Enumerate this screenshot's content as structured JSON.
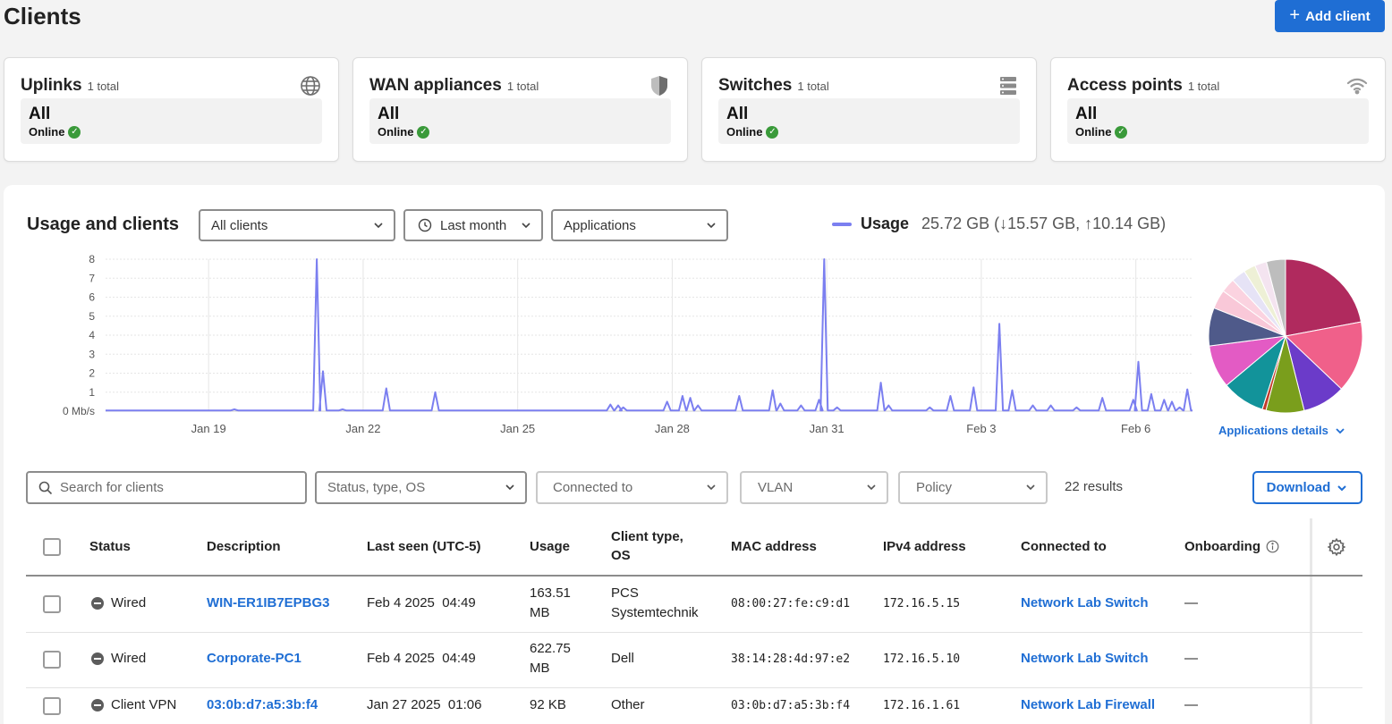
{
  "page": {
    "title": "Clients",
    "add_client_label": "Add client"
  },
  "cards": [
    {
      "title": "Uplinks",
      "total": "1 total",
      "filter": "All",
      "status": "Online",
      "icon": "globe-icon"
    },
    {
      "title": "WAN appliances",
      "total": "1 total",
      "filter": "All",
      "status": "Online",
      "icon": "shield-icon"
    },
    {
      "title": "Switches",
      "total": "1 total",
      "filter": "All",
      "status": "Online",
      "icon": "server-stack-icon"
    },
    {
      "title": "Access points",
      "total": "1 total",
      "filter": "All",
      "status": "Online",
      "icon": "wifi-icon"
    }
  ],
  "usage": {
    "title": "Usage and clients",
    "client_filter": "All clients",
    "time_filter": "Last month",
    "breakdown_filter": "Applications",
    "legend_label": "Usage",
    "legend_value": "25.72 GB (↓15.57 GB, ↑10.14 GB)",
    "apps_details_label": "Applications details"
  },
  "chart_data": {
    "type": "line",
    "series": [
      {
        "name": "Usage",
        "color": "#7b7ff0"
      }
    ],
    "ylabel_unit": "Mb/s",
    "y_ticks": [
      "0 Mb/s",
      "1",
      "2",
      "3",
      "4",
      "5",
      "6",
      "7",
      "8"
    ],
    "ylim": [
      0,
      8
    ],
    "x_ticks": [
      "Jan 19",
      "Jan 22",
      "Jan 25",
      "Jan 28",
      "Jan 31",
      "Feb 3",
      "Feb 6"
    ],
    "x_tick_days": [
      2,
      5,
      8,
      11,
      14,
      17,
      20
    ],
    "xlim_days": [
      0,
      21.1
    ],
    "spikes": [
      [
        2.5,
        0.1
      ],
      [
        4.1,
        8.0
      ],
      [
        4.22,
        2.1
      ],
      [
        4.6,
        0.1
      ],
      [
        5.45,
        1.2
      ],
      [
        6.4,
        1.0
      ],
      [
        9.8,
        0.35
      ],
      [
        9.95,
        0.3
      ],
      [
        10.05,
        0.2
      ],
      [
        10.9,
        0.5
      ],
      [
        11.2,
        0.8
      ],
      [
        11.35,
        0.7
      ],
      [
        11.5,
        0.3
      ],
      [
        12.3,
        0.8
      ],
      [
        12.95,
        1.1
      ],
      [
        13.1,
        0.4
      ],
      [
        13.5,
        0.3
      ],
      [
        13.85,
        0.6
      ],
      [
        13.95,
        8.0
      ],
      [
        14.2,
        0.2
      ],
      [
        15.05,
        1.5
      ],
      [
        15.2,
        0.3
      ],
      [
        16.0,
        0.2
      ],
      [
        16.4,
        0.8
      ],
      [
        16.85,
        1.25
      ],
      [
        17.35,
        4.6
      ],
      [
        17.6,
        1.1
      ],
      [
        18.0,
        0.3
      ],
      [
        18.35,
        0.3
      ],
      [
        18.85,
        0.2
      ],
      [
        19.35,
        0.7
      ],
      [
        19.95,
        0.6
      ],
      [
        20.05,
        2.6
      ],
      [
        20.3,
        0.9
      ],
      [
        20.55,
        0.6
      ],
      [
        20.7,
        0.5
      ],
      [
        20.85,
        0.2
      ],
      [
        21.0,
        1.15
      ]
    ],
    "pie_slices": [
      {
        "value": 22,
        "color": "#b02a5e"
      },
      {
        "value": 15,
        "color": "#f0608a"
      },
      {
        "value": 9,
        "color": "#6b3bc9"
      },
      {
        "value": 8,
        "color": "#7a9e1c"
      },
      {
        "value": 0.8,
        "color": "#c23a2a"
      },
      {
        "value": 9,
        "color": "#12939a"
      },
      {
        "value": 9,
        "color": "#e35bc4"
      },
      {
        "value": 8,
        "color": "#4f5a8a"
      },
      {
        "value": 4,
        "color": "#f9c8d8"
      },
      {
        "value": 3,
        "color": "#fbd3e0"
      },
      {
        "value": 3,
        "color": "#e6e3f6"
      },
      {
        "value": 2.5,
        "color": "#eef0d6"
      },
      {
        "value": 2.5,
        "color": "#f4e4f0"
      },
      {
        "value": 4,
        "color": "#bdbdbd"
      }
    ]
  },
  "filters": {
    "search_placeholder": "Search for clients",
    "status_type_os": "Status, type, OS",
    "connected_to": "Connected to",
    "vlan": "VLAN",
    "policy": "Policy",
    "results": "22 results",
    "download_label": "Download"
  },
  "table": {
    "headers": {
      "status": "Status",
      "description": "Description",
      "last_seen": "Last seen (UTC-5)",
      "usage": "Usage",
      "client_type_1": "Client type,",
      "client_type_2": "OS",
      "mac": "MAC address",
      "ipv4": "IPv4 address",
      "connected_to": "Connected to",
      "onboarding": "Onboarding"
    },
    "rows": [
      {
        "status": "Wired",
        "description": "WIN-ER1IB7EPBG3",
        "last_seen": "Feb 4 2025  04:49",
        "usage_1": "163.51",
        "usage_2": "MB",
        "type_1": "PCS",
        "type_2": "Systemtechnik",
        "mac": "08:00:27:fe:c9:d1",
        "ipv4": "172.16.5.15",
        "connected_to": "Network Lab Switch",
        "onboarding": "—"
      },
      {
        "status": "Wired",
        "description": "Corporate-PC1",
        "last_seen": "Feb 4 2025  04:49",
        "usage_1": "622.75",
        "usage_2": "MB",
        "type_1": "Dell",
        "type_2": "",
        "mac": "38:14:28:4d:97:e2",
        "ipv4": "172.16.5.10",
        "connected_to": "Network Lab Switch",
        "onboarding": "—"
      },
      {
        "status": "Client VPN",
        "description": "03:0b:d7:a5:3b:f4",
        "last_seen": "Jan 27 2025  01:06",
        "usage_1": "92 KB",
        "usage_2": "",
        "type_1": "Other",
        "type_2": "",
        "mac": "03:0b:d7:a5:3b:f4",
        "ipv4": "172.16.1.61",
        "connected_to": "Network Lab Firewall",
        "onboarding": "—"
      }
    ]
  }
}
